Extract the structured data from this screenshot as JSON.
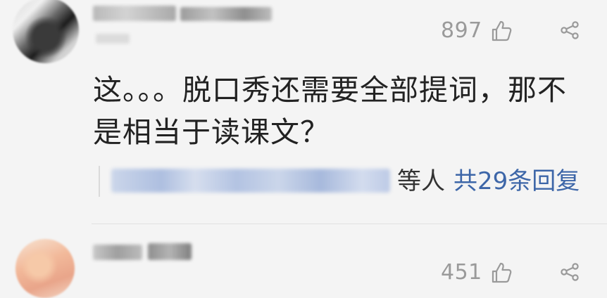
{
  "comments": [
    {
      "likes": "897",
      "text": "这。。。脱口秀还需要全部提词，那不是相当于读课文？",
      "reply_suffix": "等人",
      "reply_link": "共29条回复"
    },
    {
      "likes": "451"
    }
  ],
  "icons": {
    "like": "thumbs-up-outline-icon",
    "share": "share-icon"
  },
  "colors": {
    "background": "#f4f4f4",
    "text": "#222222",
    "muted": "#9a9a9a",
    "link": "#3d66a8"
  }
}
